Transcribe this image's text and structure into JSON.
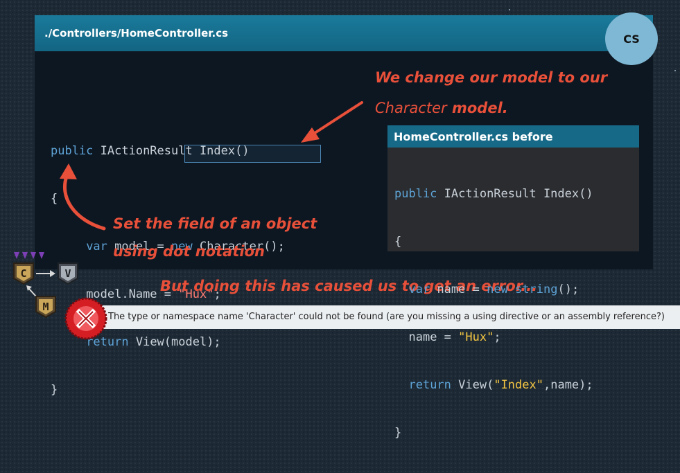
{
  "panel": {
    "title": "./Controllers/HomeController.cs",
    "badge": "CS"
  },
  "code": {
    "line1_kw": "public",
    "line1_rest": " IActionResult Index()",
    "line2": "{",
    "line3_kw": "var",
    "line3_mid": " model = ",
    "line3_new": "new",
    "line3_type": " Character();",
    "line4_a": "model.Name = ",
    "line4_str": "\"Hux\"",
    "line4_b": ";",
    "line5_kw": "return",
    "line5_rest": " View(model);",
    "line6": "}"
  },
  "annotations": {
    "model_line1": "We change our model to our",
    "model_line2a": "Character",
    "model_line2b": " model.",
    "field_line1": "Set the field of an object",
    "field_line2": "using dot notation",
    "error_caption": "But doing this has caused us to get an error..."
  },
  "before": {
    "title": "HomeController.cs before",
    "l1_kw": "public",
    "l1_rest": " IActionResult Index()",
    "l2": "{",
    "l3_kw": "var",
    "l3_mid": " name = ",
    "l3_new": "new",
    "l3_type": " string",
    "l3_end": "();",
    "l4_a": "name = ",
    "l4_str": "\"Hux\"",
    "l4_b": ";",
    "l5_kw": "return",
    "l5_a": " View(",
    "l5_str": "\"Index\"",
    "l5_b": ",name);",
    "l6": "}"
  },
  "error": {
    "message": "The type or namespace name 'Character' could not be found (are you missing a using directive or an assembly reference?)"
  },
  "mvc": {
    "c": "C",
    "v": "V",
    "m": "M"
  },
  "colors": {
    "accent": "#e8503a",
    "header": "#176a87",
    "keyword": "#5ea3d6",
    "string": "#f4c542"
  }
}
